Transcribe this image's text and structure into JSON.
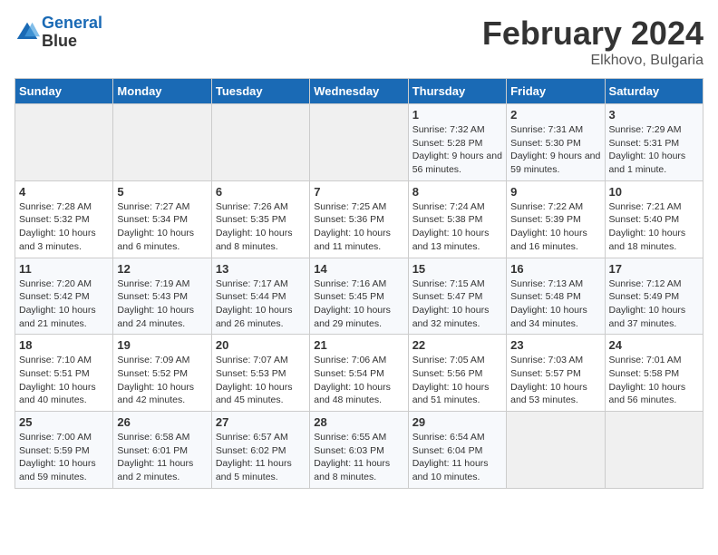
{
  "header": {
    "logo_line1": "General",
    "logo_line2": "Blue",
    "month_title": "February 2024",
    "location": "Elkhovo, Bulgaria"
  },
  "weekdays": [
    "Sunday",
    "Monday",
    "Tuesday",
    "Wednesday",
    "Thursday",
    "Friday",
    "Saturday"
  ],
  "weeks": [
    [
      {
        "day": "",
        "empty": true
      },
      {
        "day": "",
        "empty": true
      },
      {
        "day": "",
        "empty": true
      },
      {
        "day": "",
        "empty": true
      },
      {
        "day": "1",
        "sunrise": "Sunrise: 7:32 AM",
        "sunset": "Sunset: 5:28 PM",
        "daylight": "Daylight: 9 hours and 56 minutes."
      },
      {
        "day": "2",
        "sunrise": "Sunrise: 7:31 AM",
        "sunset": "Sunset: 5:30 PM",
        "daylight": "Daylight: 9 hours and 59 minutes."
      },
      {
        "day": "3",
        "sunrise": "Sunrise: 7:29 AM",
        "sunset": "Sunset: 5:31 PM",
        "daylight": "Daylight: 10 hours and 1 minute."
      }
    ],
    [
      {
        "day": "4",
        "sunrise": "Sunrise: 7:28 AM",
        "sunset": "Sunset: 5:32 PM",
        "daylight": "Daylight: 10 hours and 3 minutes."
      },
      {
        "day": "5",
        "sunrise": "Sunrise: 7:27 AM",
        "sunset": "Sunset: 5:34 PM",
        "daylight": "Daylight: 10 hours and 6 minutes."
      },
      {
        "day": "6",
        "sunrise": "Sunrise: 7:26 AM",
        "sunset": "Sunset: 5:35 PM",
        "daylight": "Daylight: 10 hours and 8 minutes."
      },
      {
        "day": "7",
        "sunrise": "Sunrise: 7:25 AM",
        "sunset": "Sunset: 5:36 PM",
        "daylight": "Daylight: 10 hours and 11 minutes."
      },
      {
        "day": "8",
        "sunrise": "Sunrise: 7:24 AM",
        "sunset": "Sunset: 5:38 PM",
        "daylight": "Daylight: 10 hours and 13 minutes."
      },
      {
        "day": "9",
        "sunrise": "Sunrise: 7:22 AM",
        "sunset": "Sunset: 5:39 PM",
        "daylight": "Daylight: 10 hours and 16 minutes."
      },
      {
        "day": "10",
        "sunrise": "Sunrise: 7:21 AM",
        "sunset": "Sunset: 5:40 PM",
        "daylight": "Daylight: 10 hours and 18 minutes."
      }
    ],
    [
      {
        "day": "11",
        "sunrise": "Sunrise: 7:20 AM",
        "sunset": "Sunset: 5:42 PM",
        "daylight": "Daylight: 10 hours and 21 minutes."
      },
      {
        "day": "12",
        "sunrise": "Sunrise: 7:19 AM",
        "sunset": "Sunset: 5:43 PM",
        "daylight": "Daylight: 10 hours and 24 minutes."
      },
      {
        "day": "13",
        "sunrise": "Sunrise: 7:17 AM",
        "sunset": "Sunset: 5:44 PM",
        "daylight": "Daylight: 10 hours and 26 minutes."
      },
      {
        "day": "14",
        "sunrise": "Sunrise: 7:16 AM",
        "sunset": "Sunset: 5:45 PM",
        "daylight": "Daylight: 10 hours and 29 minutes."
      },
      {
        "day": "15",
        "sunrise": "Sunrise: 7:15 AM",
        "sunset": "Sunset: 5:47 PM",
        "daylight": "Daylight: 10 hours and 32 minutes."
      },
      {
        "day": "16",
        "sunrise": "Sunrise: 7:13 AM",
        "sunset": "Sunset: 5:48 PM",
        "daylight": "Daylight: 10 hours and 34 minutes."
      },
      {
        "day": "17",
        "sunrise": "Sunrise: 7:12 AM",
        "sunset": "Sunset: 5:49 PM",
        "daylight": "Daylight: 10 hours and 37 minutes."
      }
    ],
    [
      {
        "day": "18",
        "sunrise": "Sunrise: 7:10 AM",
        "sunset": "Sunset: 5:51 PM",
        "daylight": "Daylight: 10 hours and 40 minutes."
      },
      {
        "day": "19",
        "sunrise": "Sunrise: 7:09 AM",
        "sunset": "Sunset: 5:52 PM",
        "daylight": "Daylight: 10 hours and 42 minutes."
      },
      {
        "day": "20",
        "sunrise": "Sunrise: 7:07 AM",
        "sunset": "Sunset: 5:53 PM",
        "daylight": "Daylight: 10 hours and 45 minutes."
      },
      {
        "day": "21",
        "sunrise": "Sunrise: 7:06 AM",
        "sunset": "Sunset: 5:54 PM",
        "daylight": "Daylight: 10 hours and 48 minutes."
      },
      {
        "day": "22",
        "sunrise": "Sunrise: 7:05 AM",
        "sunset": "Sunset: 5:56 PM",
        "daylight": "Daylight: 10 hours and 51 minutes."
      },
      {
        "day": "23",
        "sunrise": "Sunrise: 7:03 AM",
        "sunset": "Sunset: 5:57 PM",
        "daylight": "Daylight: 10 hours and 53 minutes."
      },
      {
        "day": "24",
        "sunrise": "Sunrise: 7:01 AM",
        "sunset": "Sunset: 5:58 PM",
        "daylight": "Daylight: 10 hours and 56 minutes."
      }
    ],
    [
      {
        "day": "25",
        "sunrise": "Sunrise: 7:00 AM",
        "sunset": "Sunset: 5:59 PM",
        "daylight": "Daylight: 10 hours and 59 minutes."
      },
      {
        "day": "26",
        "sunrise": "Sunrise: 6:58 AM",
        "sunset": "Sunset: 6:01 PM",
        "daylight": "Daylight: 11 hours and 2 minutes."
      },
      {
        "day": "27",
        "sunrise": "Sunrise: 6:57 AM",
        "sunset": "Sunset: 6:02 PM",
        "daylight": "Daylight: 11 hours and 5 minutes."
      },
      {
        "day": "28",
        "sunrise": "Sunrise: 6:55 AM",
        "sunset": "Sunset: 6:03 PM",
        "daylight": "Daylight: 11 hours and 8 minutes."
      },
      {
        "day": "29",
        "sunrise": "Sunrise: 6:54 AM",
        "sunset": "Sunset: 6:04 PM",
        "daylight": "Daylight: 11 hours and 10 minutes."
      },
      {
        "day": "",
        "empty": true
      },
      {
        "day": "",
        "empty": true
      }
    ]
  ]
}
